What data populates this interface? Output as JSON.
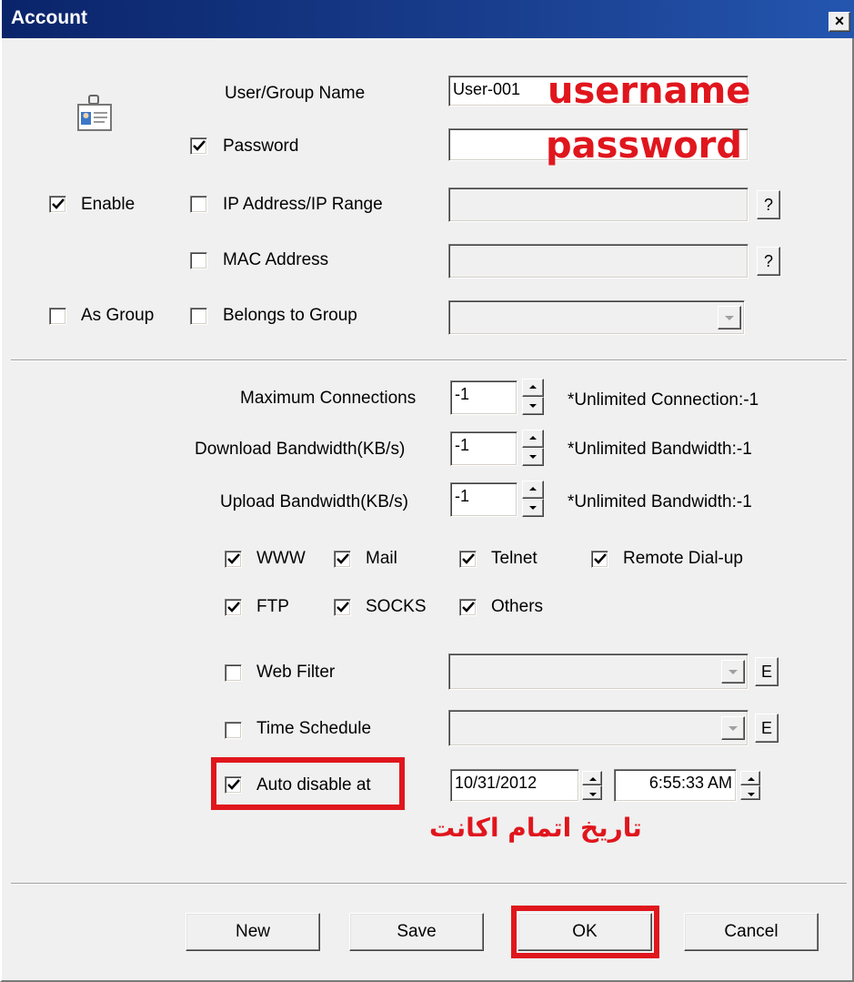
{
  "window": {
    "title": "Account",
    "close_label": "×"
  },
  "account": {
    "user_group_name_label": "User/Group Name",
    "user_group_name_value": "User-001",
    "password_label": "Password",
    "password_checked": true,
    "enable_label": "Enable",
    "enable_checked": true,
    "ip_label": "IP Address/IP Range",
    "ip_checked": false,
    "mac_label": "MAC Address",
    "mac_checked": false,
    "as_group_label": "As Group",
    "as_group_checked": false,
    "belongs_label": "Belongs to Group",
    "belongs_checked": false,
    "help_label": "?"
  },
  "limits": {
    "max_conn_label": "Maximum Connections",
    "max_conn_value": "-1",
    "max_conn_note": "*Unlimited Connection:-1",
    "download_label": "Download Bandwidth(KB/s)",
    "download_value": "-1",
    "download_note": "*Unlimited Bandwidth:-1",
    "upload_label": "Upload Bandwidth(KB/s)",
    "upload_value": "-1",
    "upload_note": "*Unlimited Bandwidth:-1"
  },
  "services": {
    "www": "WWW",
    "mail": "Mail",
    "telnet": "Telnet",
    "remote": "Remote Dial-up",
    "ftp": "FTP",
    "socks": "SOCKS",
    "others": "Others"
  },
  "filters": {
    "web_filter_label": "Web Filter",
    "web_filter_checked": false,
    "time_schedule_label": "Time Schedule",
    "time_schedule_checked": false,
    "edit_label": "E",
    "auto_disable_label": "Auto disable at",
    "auto_disable_checked": true,
    "date_value": "10/31/2012",
    "time_value": "6:55:33 AM"
  },
  "buttons": {
    "new": "New",
    "save": "Save",
    "ok": "OK",
    "cancel": "Cancel"
  },
  "annotations": {
    "username": "username",
    "password": "password",
    "expiry": "تاریخ اتمام اکانت",
    "color": "#e0161d"
  }
}
